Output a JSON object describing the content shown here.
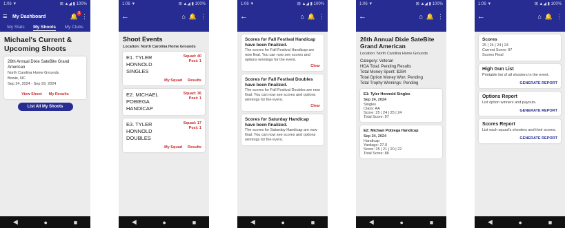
{
  "colors": {
    "brand": "#262c92",
    "accent": "#c9262a",
    "nav": "#111111"
  },
  "status": {
    "time": "1:06 ▼",
    "icons": "⊞ ▲◢ ▮ 100%"
  },
  "nav": {
    "back": "◀",
    "home": "●",
    "recents": "■"
  },
  "screens": {
    "s1": {
      "title": "My Dashboard",
      "badge": "3",
      "tabs": [
        "My Stats",
        "My Shoots",
        "My Clubs"
      ],
      "heading": "Michael's Current & Upcoming Shoots",
      "card": {
        "name": "26th Annual Dixie SateBite Grand American",
        "location": "North Carolina Home Grounds",
        "city": "Bowie, NC",
        "dates": "Sep 24, 2024 - Sep 29, 2024",
        "view_shoot": "View Shoot",
        "my_results": "My Results"
      },
      "list_button": "List All My Shoots"
    },
    "s2": {
      "title": "Shoot Events",
      "location": "Location: North Carolina Home Grounds",
      "events": [
        {
          "name": "E1. TYLER HONNOLD SINGLES",
          "squad": "Squad: 40",
          "post": "Post: 1",
          "my_squad": "My Squad",
          "results": "Results"
        },
        {
          "name": "E2. MICHAEL POBIEGA HANDICAP",
          "squad": "Squad: 36",
          "post": "Post: 1",
          "my_squad": "",
          "results": ""
        },
        {
          "name": "E3. TYLER HONNOLD DOUBLES",
          "squad": "Squad: 17",
          "post": "Post: 1",
          "my_squad": "My Squad",
          "results": "Results"
        }
      ]
    },
    "s3": {
      "notices": [
        {
          "title": "Scores for Fall Festival Handicap have been finalized.",
          "body": "The scores for Fall Festival Handicap are now final. You can now see scores and options winnings for the event.",
          "clear": "Clear"
        },
        {
          "title": "Scores for Fall Festival Doubles have been finalized.",
          "body": "The scores for Fall Festival Doubles are now final. You can now see scores and options winnings for the event.",
          "clear": "Clear"
        },
        {
          "title": "Scores for Saturday Handicap have been finalized.",
          "body": "The scores for Saturday Handicap are now final. You can now see scores and options winnings for the event.",
          "clear": ""
        }
      ]
    },
    "s4": {
      "heading": "26th Annual Dixie SateBite Grand American",
      "location": "Location: North Carolina Home Grounds",
      "category": "Category: Veteran",
      "hoa": "HOA Total: Pending Results",
      "money": "Total Money Spent: $284",
      "option_money": "Total Option Money Won: Pending",
      "trophy": "Total Trophy Winnings: Pending",
      "events": [
        {
          "title": "E1: Tyler Honnold Singles",
          "date": "Sep 24, 2024",
          "lines": [
            "Singles",
            "Class: AA",
            "Score: 25 | 24 | 25 | 24",
            "Total Score: 97"
          ]
        },
        {
          "title": "E2: Michael Pobiega Handicap",
          "date": "Sep 24, 2024",
          "lines": [
            "Handicap",
            "Yardage: 27.0",
            "Score: 25 | 21 | 20 | 22",
            "Total Score: 88"
          ]
        }
      ]
    },
    "s5": {
      "scores_card": {
        "title": "Scores",
        "line1": "25 | 24 | 24 | 24",
        "line2": "Current Score: 97",
        "line3": "Scores Final"
      },
      "reports": [
        {
          "title": "High Gun List",
          "desc": "Printable list of all shooters in the event.",
          "btn": "GENERATE REPORT"
        },
        {
          "title": "Options Report",
          "desc": "List option winners and payouts.",
          "btn": "GENERATE REPORT"
        },
        {
          "title": "Scores Report",
          "desc": "List each squad's shooters and their scores.",
          "btn": "GENERATE REPORT"
        }
      ]
    }
  }
}
